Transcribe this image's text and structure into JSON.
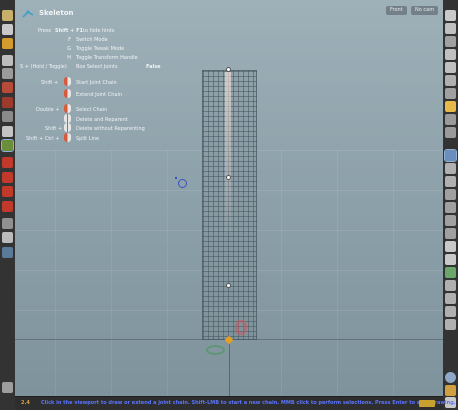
{
  "viewport": {
    "title": "Skeleton",
    "view_menu": "Front",
    "camera_menu": "No cam"
  },
  "hints": {
    "header_prefix": "Press",
    "header_key": "Shift + F1",
    "header_suffix": "to hide hints",
    "rows": [
      {
        "key": "F",
        "label": "Switch Mode"
      },
      {
        "key": "G",
        "label": "Toggle Tweak Mode"
      },
      {
        "key": "H",
        "label": "Toggle Transform Handle"
      }
    ],
    "box_select": {
      "key": "S + (Hold / Toggle)",
      "label": "Box Select Joints",
      "value": "False"
    },
    "mouse_rows": [
      {
        "key": "Shift +",
        "label": "Start Joint Chain"
      },
      {
        "key": "",
        "label": "Extend Joint Chain"
      },
      {
        "key": "Double +",
        "label": "Select Chain"
      },
      {
        "key": "",
        "label": "Delete and Reparent"
      },
      {
        "key": "Shift +",
        "label": "Delete without Reparenting"
      },
      {
        "key": "Shift + Ctrl +",
        "label": "Split Line"
      }
    ]
  },
  "scene": {
    "origin_label": "0"
  },
  "status": {
    "number": "2.4",
    "message": "Click in the viewport to draw or extend a joint chain. Shift-LMB to start a new chain. MMB click to perform selections. Press Enter to stop drawing."
  },
  "colors": {
    "accent_orange": "#d75a3a",
    "status_blue": "#5a74ff",
    "status_badge": "#c8a12e",
    "cursor_blue": "#3c4fc0"
  },
  "left_tools": [
    "hand-icon",
    "select-icon",
    "hand-pan-icon",
    "move-icon",
    "lock-icon",
    "paint-icon",
    "view-icon",
    "rotate-icon",
    "bone-icon",
    "skeleton-icon",
    "rig-icon",
    "capture-icon",
    "biceps-icon",
    "weight-icon",
    "magnet-icon",
    "eye-icon",
    "camera-icon",
    "record-icon",
    "toolbox-icon"
  ],
  "right_tools": [
    "display-icon",
    "wireframe-icon",
    "lock-icon",
    "camera-icon",
    "light-icon",
    "sphere-icon",
    "torch-icon",
    "bulb-icon",
    "texture-icon",
    "layers-icon",
    "ghost-icon",
    "paint-brush-icon",
    "wand-icon",
    "shading-icon",
    "normals-icon",
    "ruler-icon",
    "draw-icon",
    "flag-icon",
    "grid-icon",
    "dots-icon",
    "chart-icon",
    "hand-icon",
    "picker-icon",
    "guide-icon",
    "info-icon",
    "layout-icon",
    "screen-icon"
  ]
}
